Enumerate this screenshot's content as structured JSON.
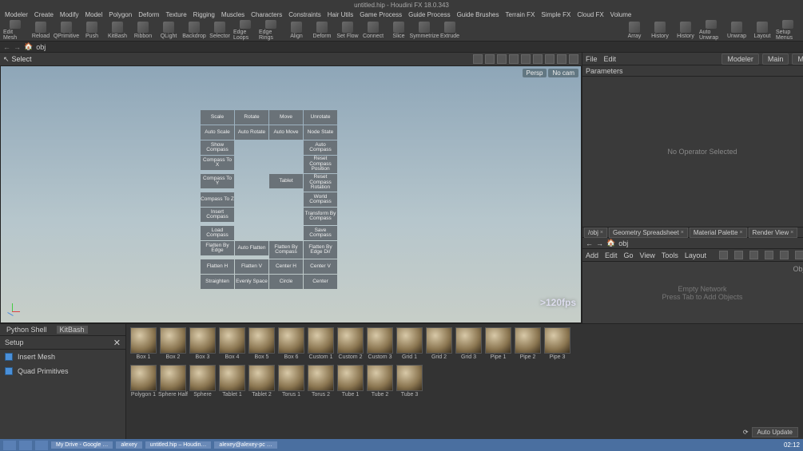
{
  "title": "untitled.hip - Houdini FX 18.0.343",
  "menubar": [
    "Modeler",
    "Create",
    "Modify",
    "Model",
    "Polygon",
    "Deform",
    "Texture",
    "Rigging",
    "Muscles",
    "Characters",
    "Constraints",
    "Hair Utils",
    "Game Process",
    "Guide Process",
    "Guide Brushes",
    "Terrain FX",
    "Simple FX",
    "Cloud FX",
    "Volume"
  ],
  "toolbar": [
    "Edit Mesh",
    "Reload",
    "QPrimitive",
    "Push",
    "KitBash",
    "Ribbon",
    "QLight",
    "Backdrop",
    "Selector",
    "Edge Loops",
    "Edge Rings",
    "Align",
    "Deform",
    "Set Flow",
    "Connect",
    "Slice",
    "Symmetrize",
    "Extrude",
    "",
    "",
    "",
    "",
    "",
    "",
    "",
    "",
    "Array",
    "History",
    "History",
    "Auto Unwrap",
    "Unwrap",
    "Layout",
    "Setup Menus"
  ],
  "path": {
    "obj": "obj"
  },
  "right_top": {
    "menu": [
      "File",
      "Edit"
    ],
    "modeler": "Modeler",
    "main": "Main",
    "main2": "Main"
  },
  "vp": {
    "select": "Select",
    "persp": "Persp",
    "nocam": "No cam",
    "fps": ">120fps"
  },
  "compass": {
    "grid": [
      "Scale",
      "Rotate",
      "Move",
      "Unrotate",
      "Auto Scale",
      "Auto Rotate",
      "Auto Move",
      "Node State",
      "Show Compass",
      "",
      "",
      "Auto Compass",
      "Compass To X",
      "",
      "",
      "Reset Compass Position",
      "Compass To Y",
      "",
      "Tablet",
      "Reset Compass Rotation",
      "Compass To Z",
      "",
      "",
      "World Compass",
      "Insert Compass",
      "",
      "",
      "Transform By Compass",
      "Load Compass",
      "",
      "",
      "Save Compass",
      "Flatten By Edge",
      "Auto Flatten",
      "Flatten By Compass",
      "Flatten By Edge Dir",
      "Flatten H",
      "Flatten V",
      "Center H",
      "Center V",
      "Straighten",
      "Evenly Space",
      "Circle",
      "Center"
    ]
  },
  "params": {
    "label": "Parameters",
    "empty": "No Operator Selected"
  },
  "net": {
    "tabs": [
      "/obj",
      "Geometry Spreadsheet",
      "Material Palette",
      "Render View"
    ],
    "path": "obj",
    "menu": [
      "Add",
      "Edit",
      "Go",
      "View",
      "Tools",
      "Layout"
    ],
    "objects_label": "Objects",
    "empty1": "Empty Network",
    "empty2": "Press Tab to Add Objects"
  },
  "bottom": {
    "tabs": [
      "Python Shell",
      "KitBash"
    ],
    "setup": "Setup",
    "side": [
      "Insert Mesh",
      "Quad Primitives"
    ],
    "thumbs1": [
      "Box 1",
      "Box 2",
      "Box 3",
      "Box 4",
      "Box 5",
      "Box 6",
      "Custom 1",
      "Custom 2",
      "Custom 3",
      "Grid 1",
      "Grid 2",
      "Grid 3",
      "Pipe 1",
      "Pipe 2",
      "Pipe 3"
    ],
    "thumbs2": [
      "Polygon 1",
      "Sphere Half",
      "Sphere",
      "Tablet 1",
      "Tablet 2",
      "Torus 1",
      "Torus 2",
      "Tube 1",
      "Tube 2",
      "Tube 3"
    ]
  },
  "status": {
    "auto_update": "Auto Update",
    "taskbar": [
      "My Drive - Google …",
      "alexey",
      "untitled.hip – Houdin…",
      "alexey@alexey-pc …"
    ],
    "clock": "02:12"
  }
}
